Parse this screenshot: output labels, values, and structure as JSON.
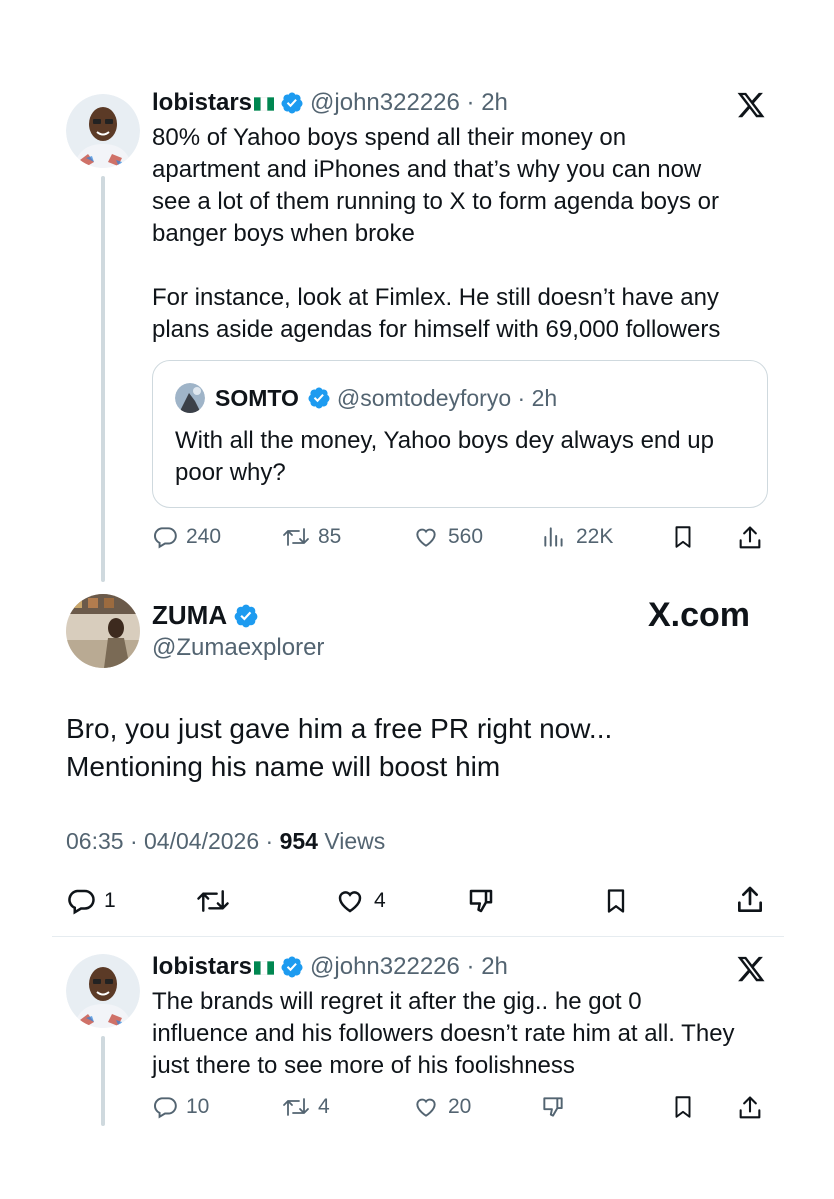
{
  "tweet1": {
    "name": "lobistars",
    "handle": "@john322226",
    "time": "2h",
    "lines": [
      "80% of Yahoo boys spend all their money on",
      "apartment and iPhones and that’s why you can now",
      "see a lot of them running to X to form agenda boys or",
      "banger boys when broke",
      "",
      "For instance, look at Fimlex. He still doesn’t have any",
      "plans aside agendas for himself with 69,000 followers"
    ],
    "quote": {
      "name": "SOMTO",
      "handle": "@somtodeyforyo",
      "time": "2h",
      "lines": [
        "With all the money, Yahoo boys dey always end up",
        "poor why?"
      ]
    },
    "stats": {
      "replies": "240",
      "reposts": "85",
      "likes": "560",
      "views": "22K"
    }
  },
  "main": {
    "name": "ZUMA",
    "handle": "@Zumaexplorer",
    "brand": "X.com",
    "lines": [
      "Bro, you just gave him a free PR right now...",
      "Mentioning his name will boost him"
    ],
    "time": "06:35",
    "date": "04/04/2026",
    "views_count": "954",
    "views_label": "Views",
    "stats": {
      "replies": "1",
      "likes": "4"
    }
  },
  "tweet3": {
    "name": "lobistars",
    "handle": "@john322226",
    "time": "2h",
    "lines": [
      "The brands will regret it after the gig.. he got 0",
      "influence and his followers doesn’t rate him at all. They",
      "just there to see more of his foolishness"
    ],
    "stats": {
      "replies": "10",
      "reposts": "4",
      "likes": "20"
    }
  },
  "colors": {
    "verified": "#1d9bf0",
    "muted": "#536471",
    "text": "#0f1419",
    "border": "#cfd9de",
    "flag_green": "#008751"
  },
  "icons": [
    "x-logo-icon",
    "verified-badge-icon",
    "nigeria-flag-icon",
    "reply-icon",
    "repost-icon",
    "like-icon",
    "views-icon",
    "bookmark-icon",
    "share-icon",
    "dislike-icon"
  ]
}
